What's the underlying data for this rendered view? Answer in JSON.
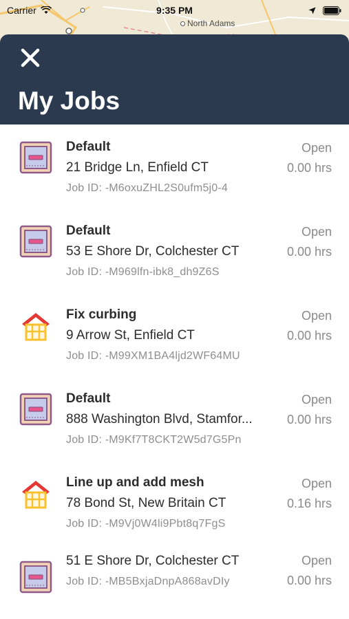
{
  "status_bar": {
    "carrier": "Carrier",
    "time": "9:35 PM"
  },
  "map": {
    "place_label": "North Adams"
  },
  "header": {
    "title": "My Jobs",
    "close_icon": "close-icon"
  },
  "colors": {
    "header_bg": "#2b3a4e",
    "secondary_text": "#8a8a8a",
    "house_roof": "#e53935",
    "house_body": "#fbc02d"
  },
  "jobs": [
    {
      "icon": "blueprint-icon",
      "title": "Default",
      "address": "21 Bridge Ln, Enfield CT",
      "job_id": "Job ID: -M6oxuZHL2S0ufm5j0-4",
      "status": "Open",
      "hours": "0.00 hrs"
    },
    {
      "icon": "blueprint-icon",
      "title": "Default",
      "address": "53 E Shore Dr, Colchester CT",
      "job_id": "Job ID: -M969lfn-ibk8_dh9Z6S",
      "status": "Open",
      "hours": "0.00 hrs"
    },
    {
      "icon": "house-icon",
      "title": "Fix curbing",
      "address": "9 Arrow St, Enfield CT",
      "job_id": "Job ID: -M99XM1BA4ljd2WF64MU",
      "status": "Open",
      "hours": "0.00 hrs"
    },
    {
      "icon": "blueprint-icon",
      "title": "Default",
      "address": "888 Washington Blvd, Stamfor...",
      "job_id": "Job ID: -M9Kf7T8CKT2W5d7G5Pn",
      "status": "Open",
      "hours": "0.00 hrs"
    },
    {
      "icon": "house-icon",
      "title": "Line up and add mesh",
      "address": "78 Bond St, New Britain CT",
      "job_id": "Job ID: -M9Vj0W4li9Pbt8q7FgS",
      "status": "Open",
      "hours": "0.16 hrs"
    },
    {
      "icon": "blueprint-icon",
      "title": "",
      "address": "51 E Shore Dr, Colchester CT",
      "job_id": "Job ID: -MB5BxjaDnpA868avDIy",
      "status": "Open",
      "hours": "0.00 hrs"
    }
  ]
}
